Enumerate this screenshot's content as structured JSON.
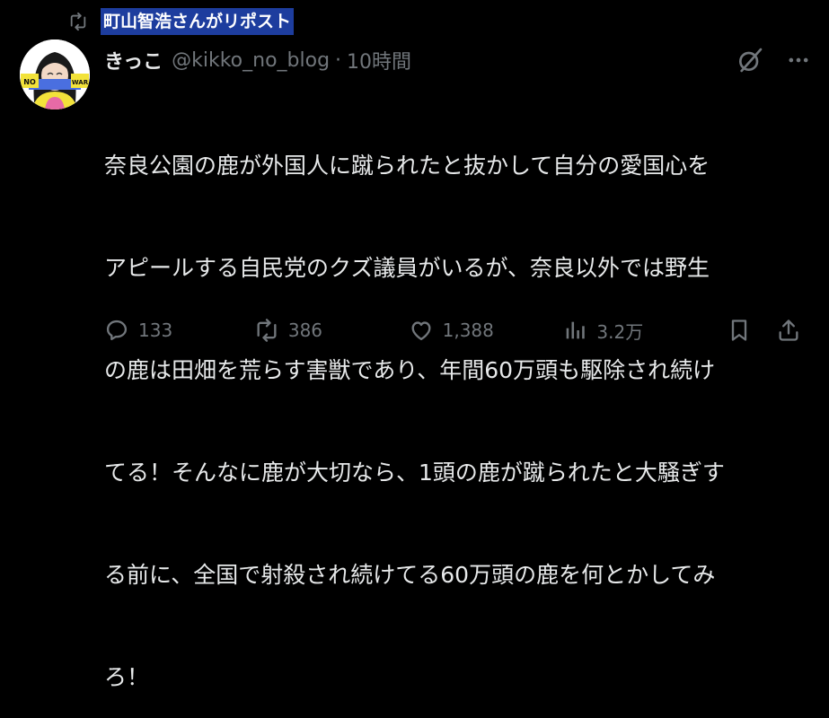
{
  "repost": {
    "icon": "repost-icon",
    "label": "町山智浩さんがリポスト"
  },
  "post": {
    "author_name": "きっこ",
    "author_handle": "@kikko_no_blog",
    "separator": "·",
    "timestamp": "10時間",
    "avatar": {
      "icon": "avatar",
      "text_left": "NO",
      "text_right": "WAR"
    },
    "text_lines": [
      "奈良公園の鹿が外国人に蹴られたと抜かして自分の愛国心を",
      "アピールする自民党のクズ議員がいるが、奈良以外では野生",
      "の鹿は田畑を荒らす害獣であり、年間60万頭も駆除され続け",
      "てる！そんなに鹿が大切なら、1頭の鹿が蹴られたと大騒ぎす",
      "る前に、全国で射殺され続けてる60万頭の鹿を何とかしてみ",
      "ろ！"
    ]
  },
  "actions": {
    "reply_count": "133",
    "repost_count": "386",
    "like_count": "1,388",
    "views_count": "3.2万"
  },
  "colors": {
    "background": "#000000",
    "text": "#e7e9ea",
    "secondary": "#71767b",
    "highlight": "#1d3d9e"
  }
}
